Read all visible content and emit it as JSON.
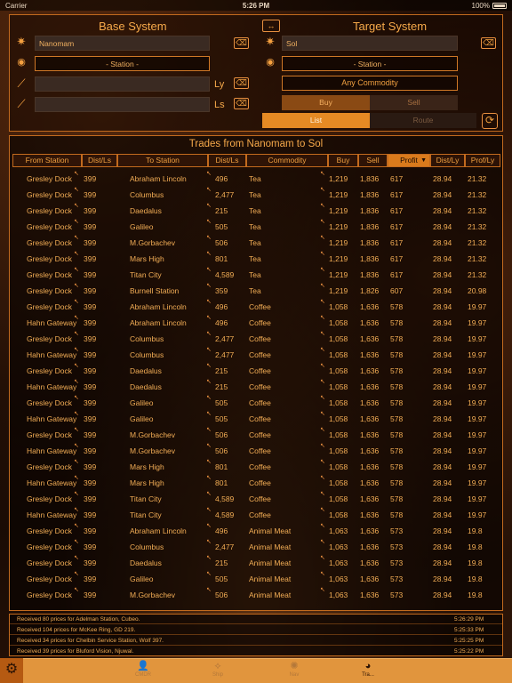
{
  "status_bar": {
    "carrier": "Carrier",
    "time": "5:26 PM",
    "battery": "100%"
  },
  "base": {
    "title": "Base System",
    "system_value": "Nanomam",
    "station_label": "- Station -",
    "field3": "",
    "field4": "",
    "unit_ly": "Ly",
    "unit_ls": "Ls"
  },
  "target": {
    "title": "Target System",
    "system_value": "Sol",
    "station_label": "- Station -",
    "commodity_label": "Any Commodity",
    "buy_label": "Buy",
    "sell_label": "Sell",
    "list_label": "List",
    "route_label": "Route"
  },
  "icons": {
    "swap": "swap-icon",
    "clear": "clear-icon",
    "star": "star-icon",
    "eye": "eye-icon",
    "wand": "wand-icon",
    "refresh": "refresh-icon",
    "settings": "gear-icon"
  },
  "table": {
    "title": "Trades from Nanomam to Sol",
    "headers": [
      "From Station",
      "Dist/Ls",
      "To Station",
      "Dist/Ls",
      "Commodity",
      "Buy",
      "Sell",
      "Profit",
      "Dist/Ly",
      "Prof/Ly"
    ],
    "sorted_header_index": 7,
    "rows": [
      [
        "Gresley Dock",
        "399",
        "Abraham Lincoln",
        "496",
        "Tea",
        "1,219",
        "1,836",
        "617",
        "28.94",
        "21.32"
      ],
      [
        "Gresley Dock",
        "399",
        "Columbus",
        "2,477",
        "Tea",
        "1,219",
        "1,836",
        "617",
        "28.94",
        "21.32"
      ],
      [
        "Gresley Dock",
        "399",
        "Daedalus",
        "215",
        "Tea",
        "1,219",
        "1,836",
        "617",
        "28.94",
        "21.32"
      ],
      [
        "Gresley Dock",
        "399",
        "Galileo",
        "505",
        "Tea",
        "1,219",
        "1,836",
        "617",
        "28.94",
        "21.32"
      ],
      [
        "Gresley Dock",
        "399",
        "M.Gorbachev",
        "506",
        "Tea",
        "1,219",
        "1,836",
        "617",
        "28.94",
        "21.32"
      ],
      [
        "Gresley Dock",
        "399",
        "Mars High",
        "801",
        "Tea",
        "1,219",
        "1,836",
        "617",
        "28.94",
        "21.32"
      ],
      [
        "Gresley Dock",
        "399",
        "Titan City",
        "4,589",
        "Tea",
        "1,219",
        "1,836",
        "617",
        "28.94",
        "21.32"
      ],
      [
        "Gresley Dock",
        "399",
        "Burnell Station",
        "359",
        "Tea",
        "1,219",
        "1,826",
        "607",
        "28.94",
        "20.98"
      ],
      [
        "Gresley Dock",
        "399",
        "Abraham Lincoln",
        "496",
        "Coffee",
        "1,058",
        "1,636",
        "578",
        "28.94",
        "19.97"
      ],
      [
        "Hahn Gateway",
        "399",
        "Abraham Lincoln",
        "496",
        "Coffee",
        "1,058",
        "1,636",
        "578",
        "28.94",
        "19.97"
      ],
      [
        "Gresley Dock",
        "399",
        "Columbus",
        "2,477",
        "Coffee",
        "1,058",
        "1,636",
        "578",
        "28.94",
        "19.97"
      ],
      [
        "Hahn Gateway",
        "399",
        "Columbus",
        "2,477",
        "Coffee",
        "1,058",
        "1,636",
        "578",
        "28.94",
        "19.97"
      ],
      [
        "Gresley Dock",
        "399",
        "Daedalus",
        "215",
        "Coffee",
        "1,058",
        "1,636",
        "578",
        "28.94",
        "19.97"
      ],
      [
        "Hahn Gateway",
        "399",
        "Daedalus",
        "215",
        "Coffee",
        "1,058",
        "1,636",
        "578",
        "28.94",
        "19.97"
      ],
      [
        "Gresley Dock",
        "399",
        "Galileo",
        "505",
        "Coffee",
        "1,058",
        "1,636",
        "578",
        "28.94",
        "19.97"
      ],
      [
        "Hahn Gateway",
        "399",
        "Galileo",
        "505",
        "Coffee",
        "1,058",
        "1,636",
        "578",
        "28.94",
        "19.97"
      ],
      [
        "Gresley Dock",
        "399",
        "M.Gorbachev",
        "506",
        "Coffee",
        "1,058",
        "1,636",
        "578",
        "28.94",
        "19.97"
      ],
      [
        "Hahn Gateway",
        "399",
        "M.Gorbachev",
        "506",
        "Coffee",
        "1,058",
        "1,636",
        "578",
        "28.94",
        "19.97"
      ],
      [
        "Gresley Dock",
        "399",
        "Mars High",
        "801",
        "Coffee",
        "1,058",
        "1,636",
        "578",
        "28.94",
        "19.97"
      ],
      [
        "Hahn Gateway",
        "399",
        "Mars High",
        "801",
        "Coffee",
        "1,058",
        "1,636",
        "578",
        "28.94",
        "19.97"
      ],
      [
        "Gresley Dock",
        "399",
        "Titan City",
        "4,589",
        "Coffee",
        "1,058",
        "1,636",
        "578",
        "28.94",
        "19.97"
      ],
      [
        "Hahn Gateway",
        "399",
        "Titan City",
        "4,589",
        "Coffee",
        "1,058",
        "1,636",
        "578",
        "28.94",
        "19.97"
      ],
      [
        "Gresley Dock",
        "399",
        "Abraham Lincoln",
        "496",
        "Animal Meat",
        "1,063",
        "1,636",
        "573",
        "28.94",
        "19.8"
      ],
      [
        "Gresley Dock",
        "399",
        "Columbus",
        "2,477",
        "Animal Meat",
        "1,063",
        "1,636",
        "573",
        "28.94",
        "19.8"
      ],
      [
        "Gresley Dock",
        "399",
        "Daedalus",
        "215",
        "Animal Meat",
        "1,063",
        "1,636",
        "573",
        "28.94",
        "19.8"
      ],
      [
        "Gresley Dock",
        "399",
        "Galileo",
        "505",
        "Animal Meat",
        "1,063",
        "1,636",
        "573",
        "28.94",
        "19.8"
      ],
      [
        "Gresley Dock",
        "399",
        "M.Gorbachev",
        "506",
        "Animal Meat",
        "1,063",
        "1,636",
        "573",
        "28.94",
        "19.8"
      ]
    ]
  },
  "log": [
    {
      "message": "Received 80 prices for Adelman Station, Cubeo.",
      "time": "5:26:29 PM"
    },
    {
      "message": "Received 104 prices for McKee Ring, GD 219.",
      "time": "5:25:33 PM"
    },
    {
      "message": "Received 34 prices for Chelbin Service Station, Wolf 397.",
      "time": "5:25:25 PM"
    },
    {
      "message": "Received 39 prices for Bluford Vision, Njuwal.",
      "time": "5:25:22 PM"
    }
  ],
  "tabs": [
    {
      "label": "CMDR",
      "icon": "person-icon"
    },
    {
      "label": "Ship",
      "icon": "ship-icon"
    },
    {
      "label": "Nav",
      "icon": "nav-icon"
    },
    {
      "label": "Tra...",
      "icon": "trade-icon"
    }
  ],
  "colors": {
    "accent": "#e1953d",
    "border": "#c26a1e",
    "text": "#f2ad55"
  }
}
